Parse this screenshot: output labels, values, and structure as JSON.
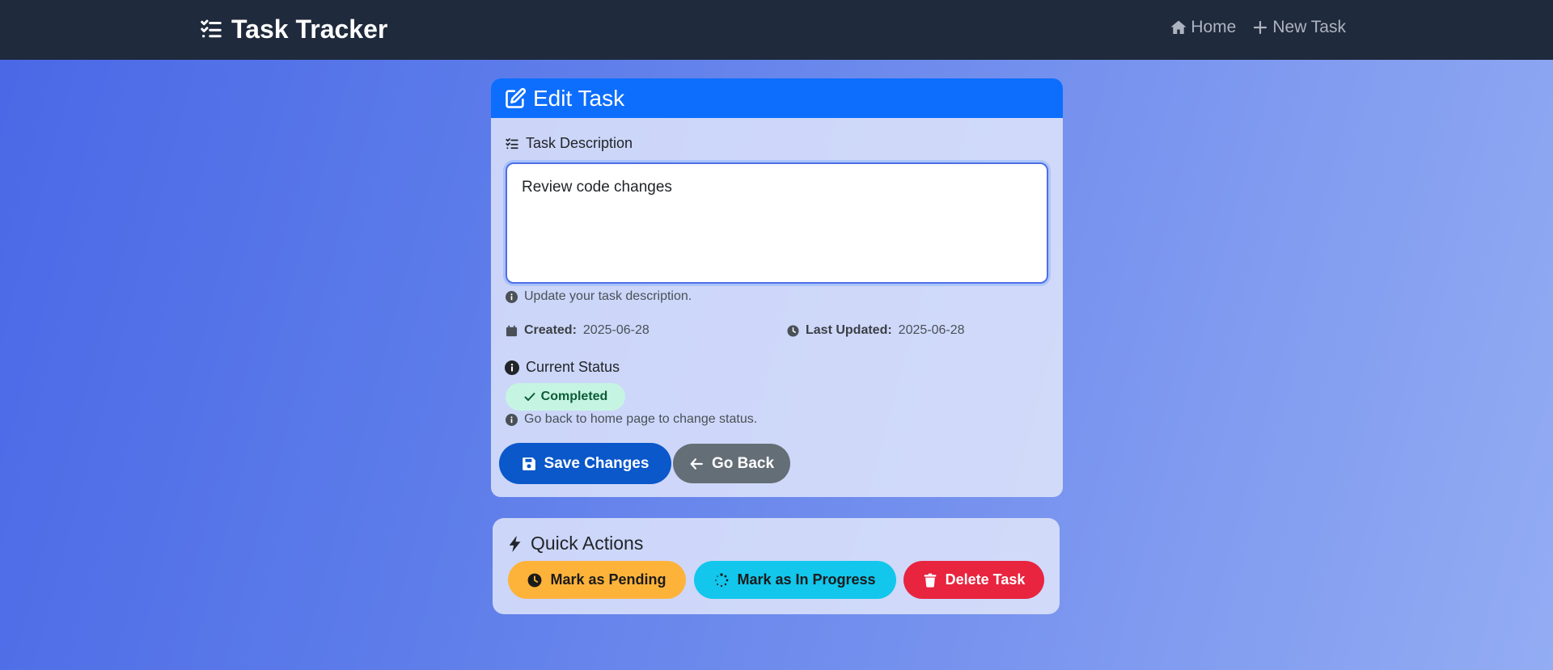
{
  "colors": {
    "navbar": "#1f2a3c",
    "primary": "#0d6efd",
    "save": "#0a58ca",
    "back": "#646e77",
    "pending": "#fdb33a",
    "in_progress": "#12c6ec",
    "delete": "#e8243f",
    "completed_badge_bg": "#c5f5e2"
  },
  "navbar": {
    "brand": "Task Tracker",
    "brand_icon": "list-check-icon",
    "links": [
      {
        "label": "Home",
        "icon": "home-icon"
      },
      {
        "label": "New Task",
        "icon": "plus-icon"
      }
    ]
  },
  "edit_card": {
    "title": "Edit Task",
    "title_icon": "edit-icon",
    "description_label": "Task Description",
    "description_value": "Review code changes",
    "description_help": "Update your task description.",
    "created_label": "Created:",
    "created_value": "2025-06-28",
    "updated_label": "Last Updated:",
    "updated_value": "2025-06-28",
    "status_label": "Current Status",
    "status_value": "Completed",
    "status_help": "Go back to home page to change status.",
    "save_label": "Save Changes",
    "back_label": "Go Back"
  },
  "quick_actions": {
    "title": "Quick Actions",
    "pending_label": "Mark as Pending",
    "progress_label": "Mark as In Progress",
    "delete_label": "Delete Task"
  }
}
